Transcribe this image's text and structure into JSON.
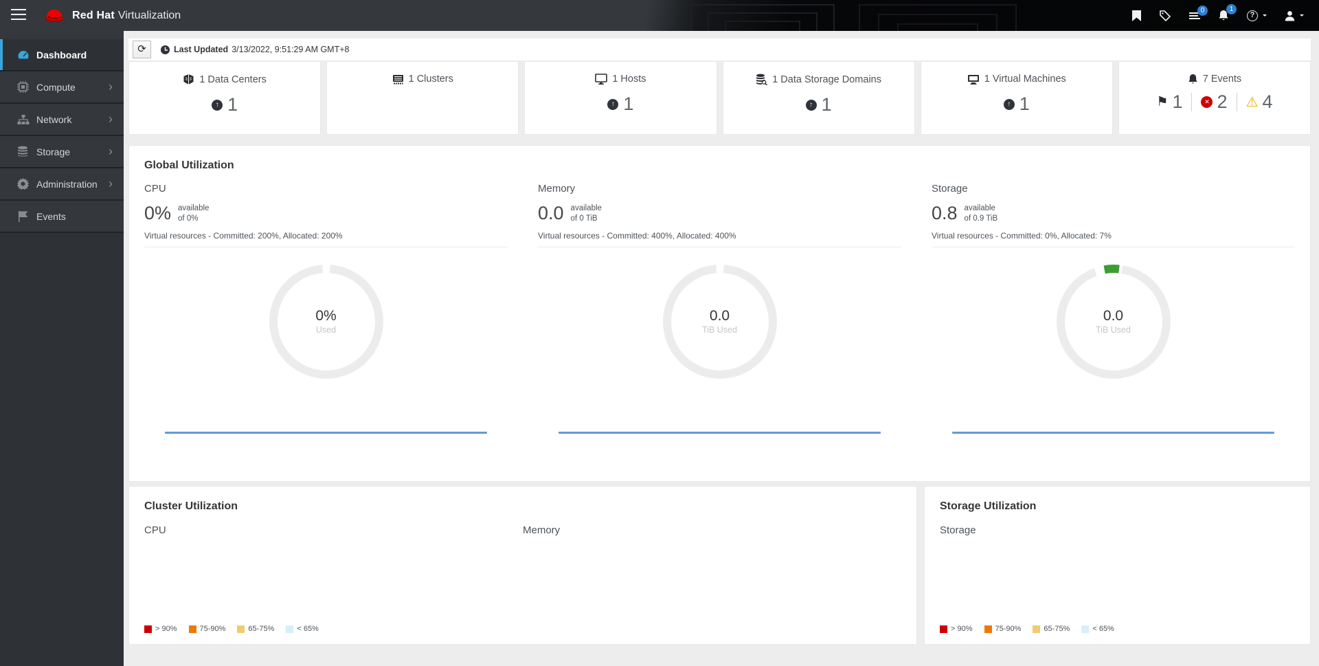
{
  "glyphs": {
    "refresh": "⟳",
    "up_arrow": "↑",
    "flag": "⚑",
    "warning": "⚠",
    "error_x": "✕",
    "help": "?",
    "chevron_right": "›"
  },
  "header": {
    "product_bold": "Red Hat",
    "product_light": "Virtualization",
    "tasks_badge": "0",
    "alerts_badge": "1"
  },
  "sidebar": {
    "items": [
      {
        "label": "Dashboard",
        "active": true,
        "chevron": false
      },
      {
        "label": "Compute",
        "active": false,
        "chevron": true
      },
      {
        "label": "Network",
        "active": false,
        "chevron": true
      },
      {
        "label": "Storage",
        "active": false,
        "chevron": true
      },
      {
        "label": "Administration",
        "active": false,
        "chevron": true
      },
      {
        "label": "Events",
        "active": false,
        "chevron": false
      }
    ]
  },
  "toolbar": {
    "last_updated_label": "Last Updated",
    "last_updated_value": "3/13/2022, 9:51:29 AM GMT+8"
  },
  "inventory": {
    "cards": [
      {
        "label": "1 Data Centers",
        "count": "1"
      },
      {
        "label": "1 Clusters",
        "count": null
      },
      {
        "label": "1 Hosts",
        "count": "1"
      },
      {
        "label": "1 Data Storage Domains",
        "count": "1"
      },
      {
        "label": "1 Virtual Machines",
        "count": "1"
      },
      {
        "label": "7 Events",
        "statuses": [
          {
            "type": "alert-flag",
            "value": "1"
          },
          {
            "type": "error",
            "value": "2",
            "color": "#cc0000"
          },
          {
            "type": "warning",
            "value": "4",
            "color": "#f0ab00"
          }
        ]
      }
    ]
  },
  "global_utilization": {
    "title": "Global Utilization",
    "columns": [
      {
        "name": "CPU",
        "value": "0%",
        "available_label": "available",
        "capacity_label": "of 0%",
        "virtual_line": "Virtual resources - Committed: 200%, Allocated: 200%",
        "donut_value": "0%",
        "donut_label": "Used",
        "used_percent": 0
      },
      {
        "name": "Memory",
        "value": "0.0",
        "available_label": "available",
        "capacity_label": "of 0 TiB",
        "virtual_line": "Virtual resources - Committed: 400%, Allocated: 400%",
        "donut_value": "0.0",
        "donut_label": "TiB Used",
        "used_percent": 0
      },
      {
        "name": "Storage",
        "value": "0.8",
        "available_label": "available",
        "capacity_label": "of 0.9 TiB",
        "virtual_line": "Virtual resources - Committed: 0%, Allocated: 7%",
        "donut_value": "0.0",
        "donut_label": "TiB Used",
        "used_percent": 4
      }
    ]
  },
  "cluster_utilization": {
    "title": "Cluster Utilization",
    "cpu_label": "CPU",
    "memory_label": "Memory"
  },
  "storage_utilization": {
    "title": "Storage Utilization",
    "storage_label": "Storage"
  },
  "legend": {
    "items": [
      {
        "label": "> 90%",
        "color": "#cc0000"
      },
      {
        "label": "75-90%",
        "color": "#ec7a08"
      },
      {
        "label": "65-75%",
        "color": "#f0cc71"
      },
      {
        "label": "< 65%",
        "color": "#d4f0fa"
      }
    ]
  },
  "colors": {
    "accent_blue": "#39a5dc",
    "donut_green": "#3f9c35",
    "badge_blue": "#2b7fd4",
    "spark_blue": "#4e87c6"
  }
}
